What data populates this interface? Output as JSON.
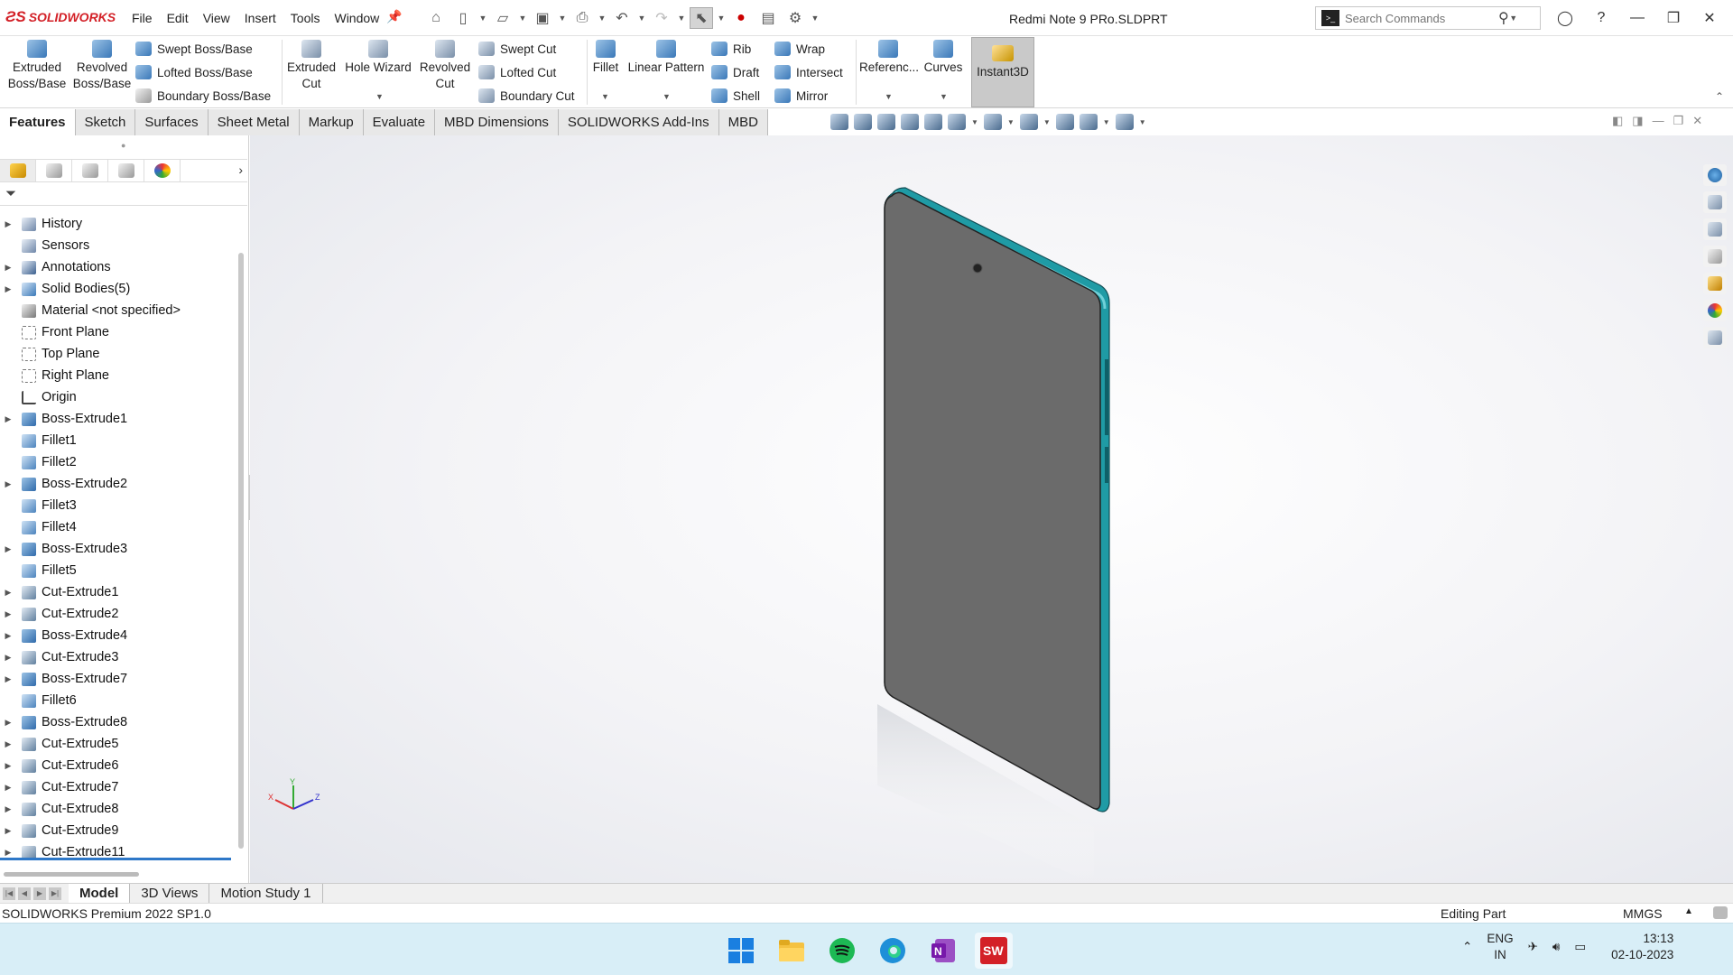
{
  "app": {
    "brand": "SOLIDWORKS",
    "document_title": "Redmi Note 9 PRo.SLDPRT"
  },
  "menu": [
    "File",
    "Edit",
    "View",
    "Insert",
    "Tools",
    "Window"
  ],
  "search": {
    "placeholder": "Search Commands"
  },
  "commands": {
    "extruded_boss": "Extruded Boss/Base",
    "revolved_boss": "Revolved Boss/Base",
    "swept_boss": "Swept Boss/Base",
    "lofted_boss": "Lofted Boss/Base",
    "boundary_boss": "Boundary Boss/Base",
    "extruded_cut": "Extruded Cut",
    "hole_wizard": "Hole Wizard",
    "revolved_cut": "Revolved Cut",
    "swept_cut": "Swept Cut",
    "lofted_cut": "Lofted Cut",
    "boundary_cut": "Boundary Cut",
    "fillet": "Fillet",
    "linear_pattern": "Linear Pattern",
    "rib": "Rib",
    "draft": "Draft",
    "shell": "Shell",
    "wrap": "Wrap",
    "intersect": "Intersect",
    "mirror": "Mirror",
    "reference": "Referenc...",
    "curves": "Curves",
    "instant3d": "Instant3D"
  },
  "tabs": [
    "Features",
    "Sketch",
    "Surfaces",
    "Sheet Metal",
    "Markup",
    "Evaluate",
    "MBD Dimensions",
    "SOLIDWORKS Add-Ins",
    "MBD"
  ],
  "active_tab": "Features",
  "tree": [
    {
      "label": "History",
      "expandable": true,
      "icon": "history-icon"
    },
    {
      "label": "Sensors",
      "expandable": false,
      "icon": "sensor-icon"
    },
    {
      "label": "Annotations",
      "expandable": true,
      "icon": "annotation-icon"
    },
    {
      "label": "Solid Bodies(5)",
      "expandable": true,
      "icon": "solid-bodies-icon"
    },
    {
      "label": "Material <not specified>",
      "expandable": false,
      "icon": "material-icon"
    },
    {
      "label": "Front Plane",
      "expandable": false,
      "icon": "plane-icon"
    },
    {
      "label": "Top Plane",
      "expandable": false,
      "icon": "plane-icon"
    },
    {
      "label": "Right Plane",
      "expandable": false,
      "icon": "plane-icon"
    },
    {
      "label": "Origin",
      "expandable": false,
      "icon": "origin-icon"
    },
    {
      "label": "Boss-Extrude1",
      "expandable": true,
      "icon": "boss-extrude-icon"
    },
    {
      "label": "Fillet1",
      "expandable": false,
      "icon": "fillet-icon"
    },
    {
      "label": "Fillet2",
      "expandable": false,
      "icon": "fillet-icon"
    },
    {
      "label": "Boss-Extrude2",
      "expandable": true,
      "icon": "boss-extrude-icon"
    },
    {
      "label": "Fillet3",
      "expandable": false,
      "icon": "fillet-icon"
    },
    {
      "label": "Fillet4",
      "expandable": false,
      "icon": "fillet-icon"
    },
    {
      "label": "Boss-Extrude3",
      "expandable": true,
      "icon": "boss-extrude-icon"
    },
    {
      "label": "Fillet5",
      "expandable": false,
      "icon": "fillet-icon"
    },
    {
      "label": "Cut-Extrude1",
      "expandable": true,
      "icon": "cut-extrude-icon"
    },
    {
      "label": "Cut-Extrude2",
      "expandable": true,
      "icon": "cut-extrude-icon"
    },
    {
      "label": "Boss-Extrude4",
      "expandable": true,
      "icon": "boss-extrude-icon"
    },
    {
      "label": "Cut-Extrude3",
      "expandable": true,
      "icon": "cut-extrude-icon"
    },
    {
      "label": "Boss-Extrude7",
      "expandable": true,
      "icon": "boss-extrude-icon"
    },
    {
      "label": "Fillet6",
      "expandable": false,
      "icon": "fillet-icon"
    },
    {
      "label": "Boss-Extrude8",
      "expandable": true,
      "icon": "boss-extrude-icon"
    },
    {
      "label": "Cut-Extrude5",
      "expandable": true,
      "icon": "cut-extrude-icon"
    },
    {
      "label": "Cut-Extrude6",
      "expandable": true,
      "icon": "cut-extrude-icon"
    },
    {
      "label": "Cut-Extrude7",
      "expandable": true,
      "icon": "cut-extrude-icon"
    },
    {
      "label": "Cut-Extrude8",
      "expandable": true,
      "icon": "cut-extrude-icon"
    },
    {
      "label": "Cut-Extrude9",
      "expandable": true,
      "icon": "cut-extrude-icon"
    },
    {
      "label": "Cut-Extrude11",
      "expandable": true,
      "icon": "cut-extrude-icon"
    }
  ],
  "bottom_tabs": [
    "Model",
    "3D Views",
    "Motion Study 1"
  ],
  "active_bottom_tab": "Model",
  "status": {
    "version": "SOLIDWORKS Premium 2022 SP1.0",
    "mode": "Editing Part",
    "units": "MMGS"
  },
  "triad": {
    "x": "X",
    "y": "Y",
    "z": "Z"
  },
  "taskbar": {
    "apps": [
      "windows-start-icon",
      "file-explorer-icon",
      "spotify-icon",
      "edge-icon",
      "onenote-icon",
      "solidworks-icon"
    ],
    "lang_top": "ENG",
    "lang_bottom": "IN",
    "time": "13:13",
    "date": "02-10-2023"
  },
  "colors": {
    "brand_red": "#d32027",
    "phone_body": "#6b6b6b",
    "phone_frame": "#1f9ba5",
    "accent_blue": "#2e78c8"
  }
}
